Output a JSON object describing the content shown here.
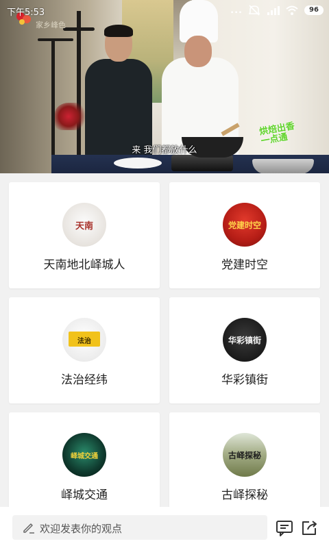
{
  "status_bar": {
    "time": "下午5:53",
    "signal_dots": "...",
    "battery": "96"
  },
  "video": {
    "subtitle": "来 我们都放什么",
    "show_logo": "烘焙出香 一点通",
    "channel_text": "家乡峰色"
  },
  "channels": [
    {
      "name": "天南地北峄城人",
      "thumb_text": "天南"
    },
    {
      "name": "党建时空",
      "thumb_text": "党建时空"
    },
    {
      "name": "法治经纬",
      "thumb_text": "法治"
    },
    {
      "name": "华彩镇街",
      "thumb_text": "华彩镇街"
    },
    {
      "name": "峄城交通",
      "thumb_text": "峄城交通"
    },
    {
      "name": "古峄探秘",
      "thumb_text": "古峄探秘"
    }
  ],
  "comment": {
    "placeholder": "欢迎发表你的观点"
  },
  "icons": {
    "edit": "pencil-icon",
    "comments": "comment-icon",
    "share": "share-icon"
  }
}
